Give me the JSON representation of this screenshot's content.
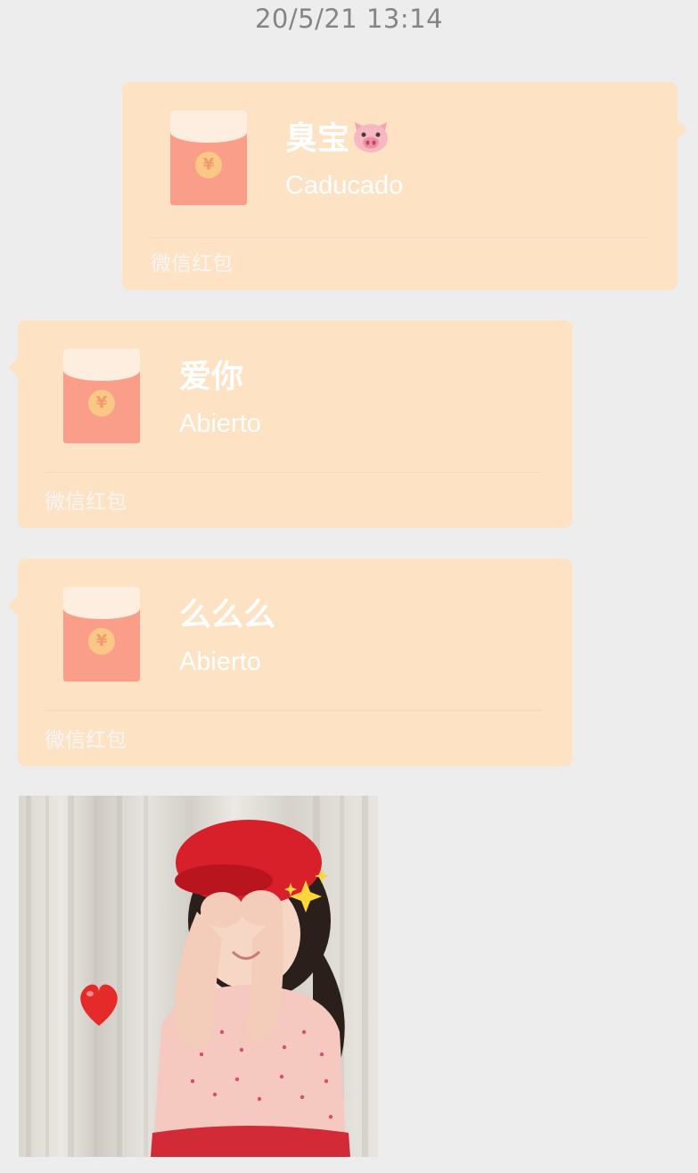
{
  "timestamp": "20/5/21 13:14",
  "messages": [
    {
      "side": "right",
      "greeting": "臭宝",
      "greeting_emoji": "pig-face-icon",
      "status": "Caducado",
      "brand": "微信红包"
    },
    {
      "side": "left",
      "greeting": "爱你",
      "status": "Abierto",
      "brand": "微信红包"
    },
    {
      "side": "left",
      "greeting": "么么么",
      "status": "Abierto",
      "brand": "微信红包"
    }
  ],
  "envelope_symbol": "¥",
  "photo": {
    "type": "image-message",
    "decorations": [
      "sparkles-icon",
      "red-heart-icon"
    ]
  },
  "colors": {
    "background": "#ededed",
    "bubble": "#fde2c4",
    "envelope": "#fa9d89",
    "envelope_flap": "#fdeee0",
    "coin": "#f8c884",
    "text": "#ffffff",
    "timestamp": "#858585"
  }
}
